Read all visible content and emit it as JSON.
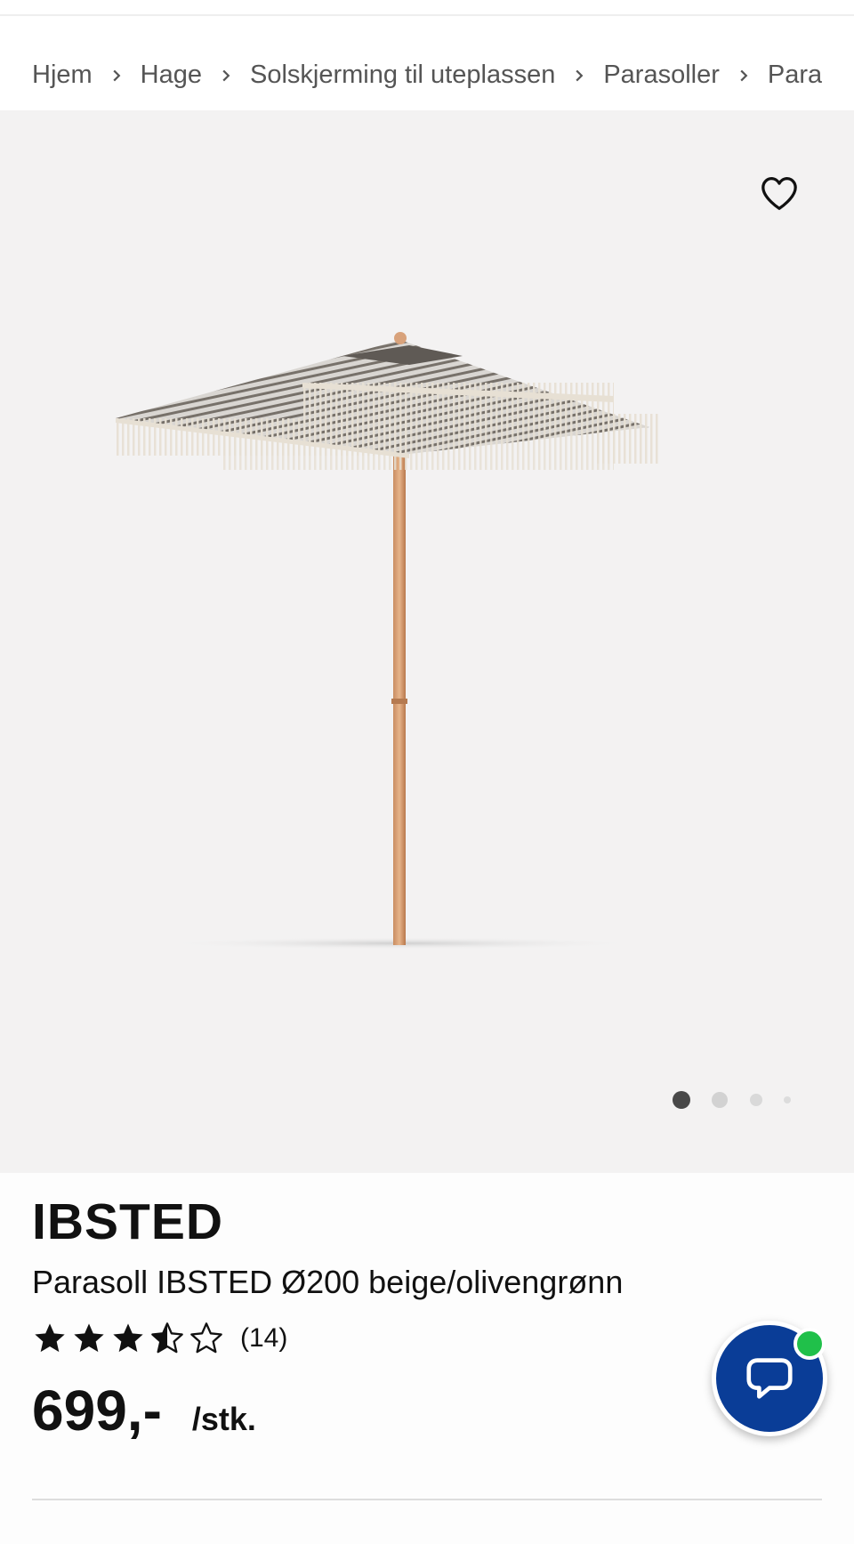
{
  "breadcrumb": {
    "items": [
      {
        "label": "Hjem"
      },
      {
        "label": "Hage"
      },
      {
        "label": "Solskjerming til uteplassen"
      },
      {
        "label": "Parasoller"
      },
      {
        "label": "Para"
      }
    ],
    "separator_icon": "chevron-right-icon"
  },
  "gallery": {
    "favorite_icon": "heart-outline-icon",
    "image_alt": "Parasoll IBSTED Ø200 beige/olivengrønn",
    "slides_total": 4,
    "active_slide": 1,
    "background": "#f3f2f2"
  },
  "product": {
    "brand": "IBSTED",
    "description": "Parasoll IBSTED Ø200 beige/olivengrønn",
    "rating": {
      "value": 3.5,
      "max": 5,
      "count_label": "(14)"
    },
    "price": {
      "value": "699,-",
      "unit": "/stk."
    }
  },
  "chat": {
    "icon": "chat-bubble-icon",
    "status_icon": "online-status-dot",
    "color": "#0a3d97",
    "status_color": "#20c04a"
  }
}
